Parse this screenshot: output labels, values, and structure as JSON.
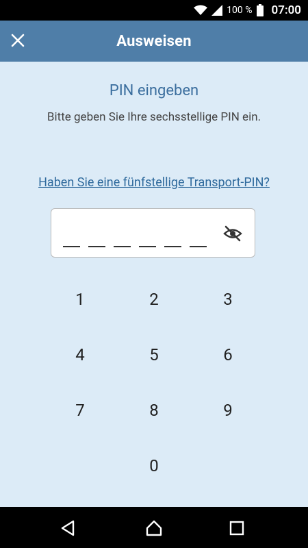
{
  "status_bar": {
    "battery_percent": "100 %",
    "time": "07:00",
    "icons": [
      "wifi-icon",
      "signal-icon",
      "battery-icon"
    ]
  },
  "app_bar": {
    "title": "Ausweisen",
    "close_icon": "close-icon"
  },
  "pin_entry": {
    "heading": "PIN eingeben",
    "instruction": "Bitte geben Sie Ihre sechsstellige PIN ein.",
    "transport_pin_link": "Haben Sie eine fünfstellige Transport-PIN?",
    "digits_entered": 0,
    "slot_count": 6,
    "visibility_icon": "eye-off-icon"
  },
  "keypad": {
    "keys": [
      "1",
      "2",
      "3",
      "4",
      "5",
      "6",
      "7",
      "8",
      "9",
      "0"
    ]
  },
  "nav_bar": {
    "icons": [
      "back-icon",
      "home-icon",
      "recents-icon"
    ]
  },
  "colors": {
    "app_bar": "#4f7ea8",
    "background": "#dcebf7",
    "heading": "#3b6e9e",
    "link": "#2f6a9d"
  }
}
